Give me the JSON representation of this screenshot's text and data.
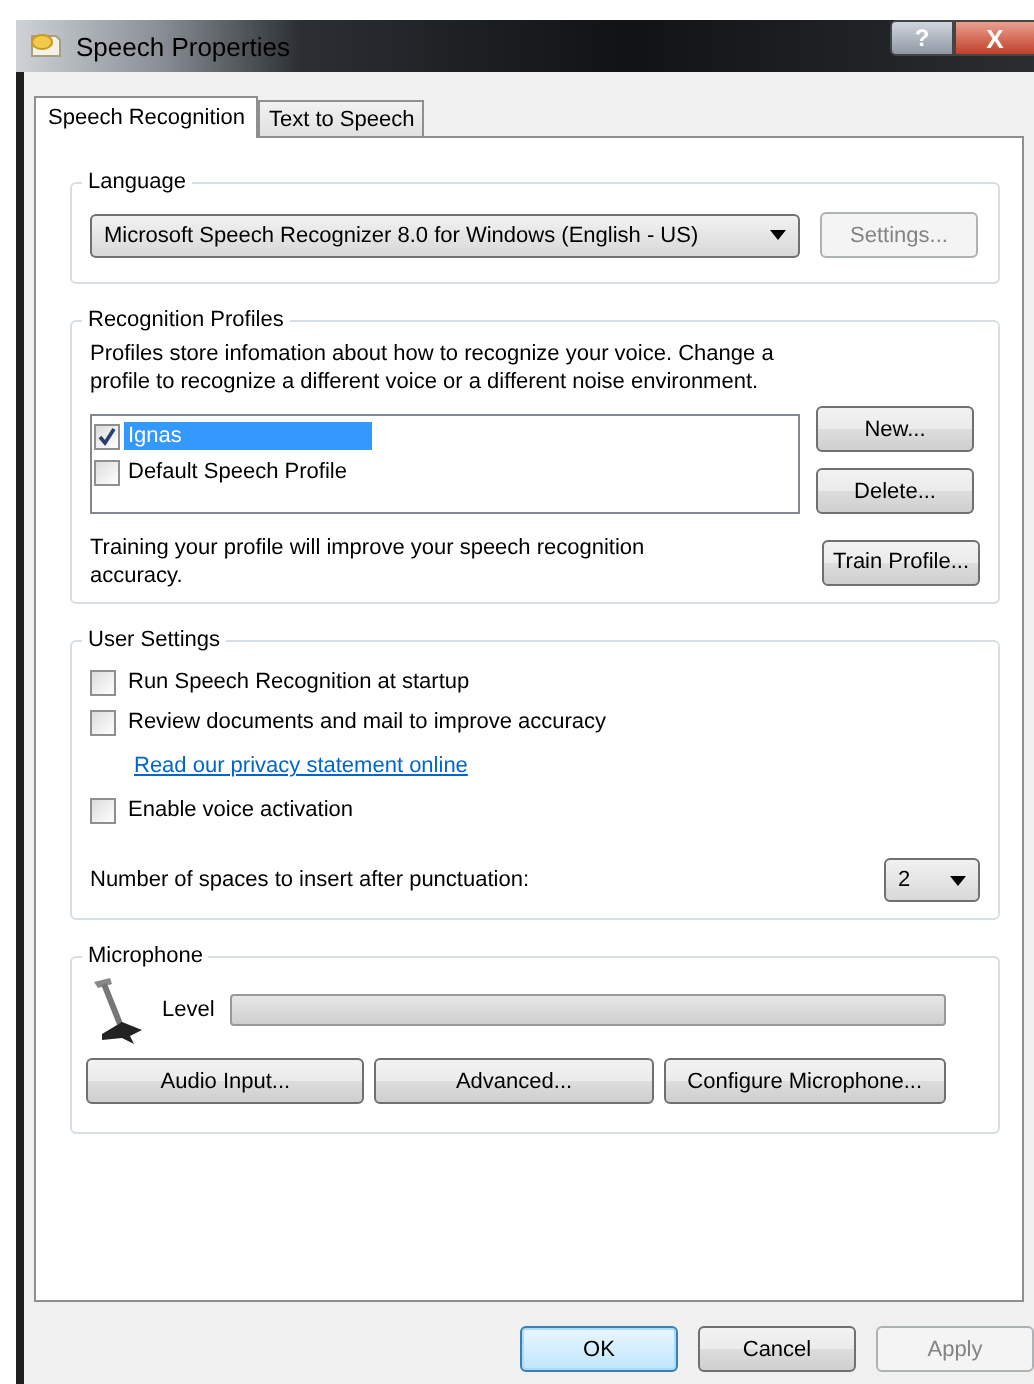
{
  "window": {
    "title": "Speech Properties",
    "help_button": "?",
    "close_button": "X"
  },
  "tabs": [
    {
      "label": "Speech Recognition",
      "selected": true
    },
    {
      "label": "Text to Speech",
      "selected": false
    }
  ],
  "language": {
    "title": "Language",
    "recognizer": "Microsoft Speech Recognizer 8.0 for Windows (English - US)",
    "settings_button": {
      "label": "Settings...",
      "disabled": true
    }
  },
  "recognition_profiles": {
    "title": "Recognition Profiles",
    "description": "Profiles store infomation about how to recognize your voice. Change a profile to recognize a different voice or a different noise environment.",
    "profiles": [
      {
        "name": "Ignas",
        "checked": true,
        "selected": true
      },
      {
        "name": "Default Speech Profile",
        "checked": false,
        "selected": false
      }
    ],
    "new_button": "New...",
    "delete_button": "Delete...",
    "training_text": "Training your profile will improve your speech recognition accuracy.",
    "train_button": "Train Profile..."
  },
  "user_settings": {
    "title": "User Settings",
    "options": [
      {
        "kind": "checkbox",
        "label": "Run Speech Recognition at startup",
        "checked": false
      },
      {
        "kind": "checkbox",
        "label": "Review documents and mail to improve accuracy",
        "checked": false
      },
      {
        "kind": "link",
        "label": "Read our privacy statement online"
      },
      {
        "kind": "checkbox",
        "label": "Enable voice activation",
        "checked": false
      }
    ],
    "spaces_label": "Number of spaces to insert after punctuation:",
    "spaces_value": "2"
  },
  "microphone": {
    "title": "Microphone",
    "level_label": "Level",
    "level": 0,
    "buttons": [
      "Audio Input...",
      "Advanced...",
      "Configure Microphone..."
    ]
  },
  "buttons": [
    {
      "label": "OK",
      "default": true,
      "disabled": false
    },
    {
      "label": "Cancel",
      "default": false,
      "disabled": false
    },
    {
      "label": "Apply",
      "default": false,
      "disabled": true
    }
  ]
}
